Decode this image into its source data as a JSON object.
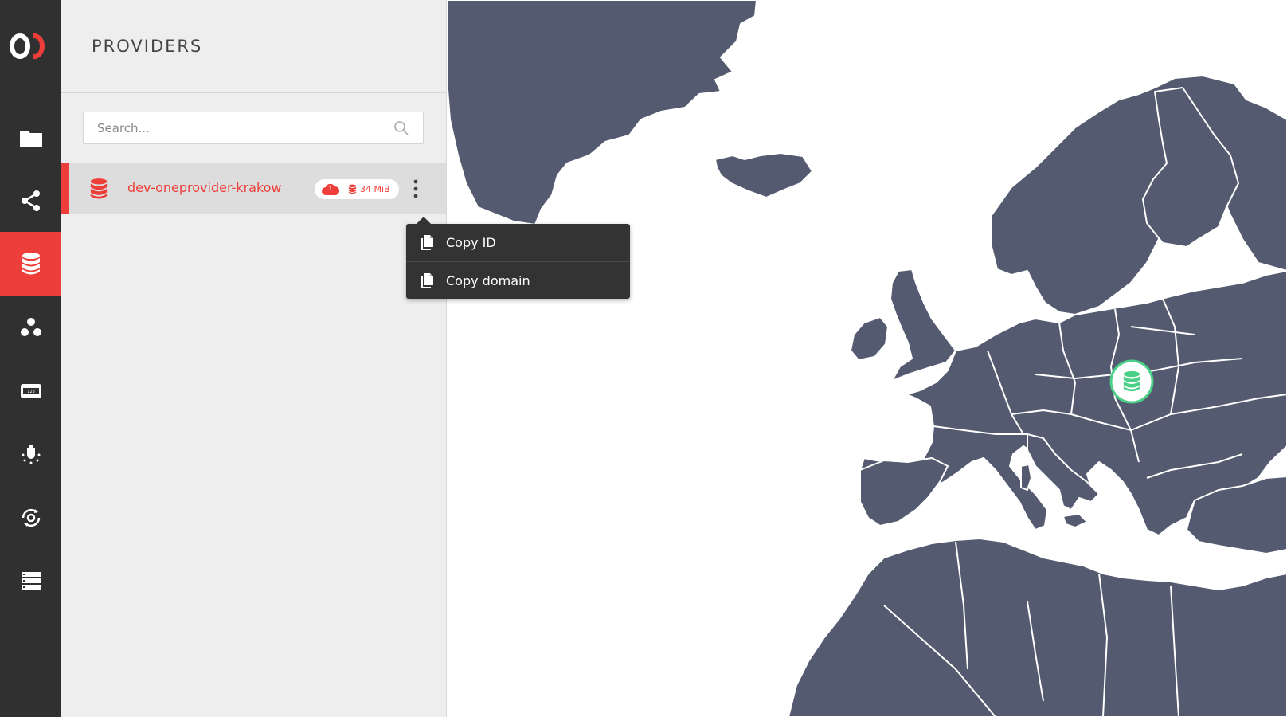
{
  "colors": {
    "accent": "#ee3e39",
    "rail": "#303030",
    "panel": "#eeeeee",
    "map_land": "#545b70",
    "online": "#4bd187"
  },
  "rail": {
    "logo": "onedata-logo",
    "items": [
      {
        "icon": "folder-icon",
        "active": false
      },
      {
        "icon": "share-icon",
        "active": false
      },
      {
        "icon": "providers-icon",
        "active": true
      },
      {
        "icon": "groups-icon",
        "active": false
      },
      {
        "icon": "tokens-icon",
        "active": false
      },
      {
        "icon": "harvesters-icon",
        "active": false
      },
      {
        "icon": "automation-icon",
        "active": false
      },
      {
        "icon": "clusters-icon",
        "active": false
      }
    ]
  },
  "panel": {
    "title": "PROVIDERS",
    "search": {
      "placeholder": "Search...",
      "value": ""
    },
    "providers": [
      {
        "name": "dev-oneprovider-krakow",
        "cloud_count": "1",
        "size": "34 MiB",
        "status": "online"
      }
    ]
  },
  "context_menu": {
    "items": [
      {
        "label": "Copy ID",
        "icon": "copy-icon"
      },
      {
        "label": "Copy domain",
        "icon": "copy-icon"
      }
    ]
  }
}
